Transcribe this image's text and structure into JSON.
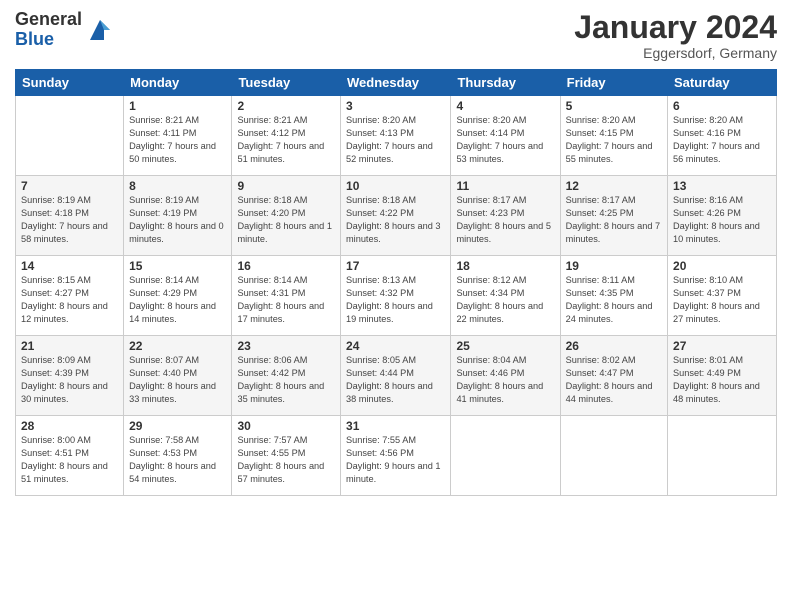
{
  "logo": {
    "general": "General",
    "blue": "Blue"
  },
  "title": "January 2024",
  "location": "Eggersdorf, Germany",
  "days_header": [
    "Sunday",
    "Monday",
    "Tuesday",
    "Wednesday",
    "Thursday",
    "Friday",
    "Saturday"
  ],
  "weeks": [
    [
      {
        "day": null
      },
      {
        "day": "1",
        "sunrise": "8:21 AM",
        "sunset": "4:11 PM",
        "daylight": "7 hours and 50 minutes."
      },
      {
        "day": "2",
        "sunrise": "8:21 AM",
        "sunset": "4:12 PM",
        "daylight": "7 hours and 51 minutes."
      },
      {
        "day": "3",
        "sunrise": "8:20 AM",
        "sunset": "4:13 PM",
        "daylight": "7 hours and 52 minutes."
      },
      {
        "day": "4",
        "sunrise": "8:20 AM",
        "sunset": "4:14 PM",
        "daylight": "7 hours and 53 minutes."
      },
      {
        "day": "5",
        "sunrise": "8:20 AM",
        "sunset": "4:15 PM",
        "daylight": "7 hours and 55 minutes."
      },
      {
        "day": "6",
        "sunrise": "8:20 AM",
        "sunset": "4:16 PM",
        "daylight": "7 hours and 56 minutes."
      }
    ],
    [
      {
        "day": "7",
        "sunrise": "8:19 AM",
        "sunset": "4:18 PM",
        "daylight": "7 hours and 58 minutes."
      },
      {
        "day": "8",
        "sunrise": "8:19 AM",
        "sunset": "4:19 PM",
        "daylight": "8 hours and 0 minutes."
      },
      {
        "day": "9",
        "sunrise": "8:18 AM",
        "sunset": "4:20 PM",
        "daylight": "8 hours and 1 minute."
      },
      {
        "day": "10",
        "sunrise": "8:18 AM",
        "sunset": "4:22 PM",
        "daylight": "8 hours and 3 minutes."
      },
      {
        "day": "11",
        "sunrise": "8:17 AM",
        "sunset": "4:23 PM",
        "daylight": "8 hours and 5 minutes."
      },
      {
        "day": "12",
        "sunrise": "8:17 AM",
        "sunset": "4:25 PM",
        "daylight": "8 hours and 7 minutes."
      },
      {
        "day": "13",
        "sunrise": "8:16 AM",
        "sunset": "4:26 PM",
        "daylight": "8 hours and 10 minutes."
      }
    ],
    [
      {
        "day": "14",
        "sunrise": "8:15 AM",
        "sunset": "4:27 PM",
        "daylight": "8 hours and 12 minutes."
      },
      {
        "day": "15",
        "sunrise": "8:14 AM",
        "sunset": "4:29 PM",
        "daylight": "8 hours and 14 minutes."
      },
      {
        "day": "16",
        "sunrise": "8:14 AM",
        "sunset": "4:31 PM",
        "daylight": "8 hours and 17 minutes."
      },
      {
        "day": "17",
        "sunrise": "8:13 AM",
        "sunset": "4:32 PM",
        "daylight": "8 hours and 19 minutes."
      },
      {
        "day": "18",
        "sunrise": "8:12 AM",
        "sunset": "4:34 PM",
        "daylight": "8 hours and 22 minutes."
      },
      {
        "day": "19",
        "sunrise": "8:11 AM",
        "sunset": "4:35 PM",
        "daylight": "8 hours and 24 minutes."
      },
      {
        "day": "20",
        "sunrise": "8:10 AM",
        "sunset": "4:37 PM",
        "daylight": "8 hours and 27 minutes."
      }
    ],
    [
      {
        "day": "21",
        "sunrise": "8:09 AM",
        "sunset": "4:39 PM",
        "daylight": "8 hours and 30 minutes."
      },
      {
        "day": "22",
        "sunrise": "8:07 AM",
        "sunset": "4:40 PM",
        "daylight": "8 hours and 33 minutes."
      },
      {
        "day": "23",
        "sunrise": "8:06 AM",
        "sunset": "4:42 PM",
        "daylight": "8 hours and 35 minutes."
      },
      {
        "day": "24",
        "sunrise": "8:05 AM",
        "sunset": "4:44 PM",
        "daylight": "8 hours and 38 minutes."
      },
      {
        "day": "25",
        "sunrise": "8:04 AM",
        "sunset": "4:46 PM",
        "daylight": "8 hours and 41 minutes."
      },
      {
        "day": "26",
        "sunrise": "8:02 AM",
        "sunset": "4:47 PM",
        "daylight": "8 hours and 44 minutes."
      },
      {
        "day": "27",
        "sunrise": "8:01 AM",
        "sunset": "4:49 PM",
        "daylight": "8 hours and 48 minutes."
      }
    ],
    [
      {
        "day": "28",
        "sunrise": "8:00 AM",
        "sunset": "4:51 PM",
        "daylight": "8 hours and 51 minutes."
      },
      {
        "day": "29",
        "sunrise": "7:58 AM",
        "sunset": "4:53 PM",
        "daylight": "8 hours and 54 minutes."
      },
      {
        "day": "30",
        "sunrise": "7:57 AM",
        "sunset": "4:55 PM",
        "daylight": "8 hours and 57 minutes."
      },
      {
        "day": "31",
        "sunrise": "7:55 AM",
        "sunset": "4:56 PM",
        "daylight": "9 hours and 1 minute."
      },
      {
        "day": null
      },
      {
        "day": null
      },
      {
        "day": null
      }
    ]
  ]
}
